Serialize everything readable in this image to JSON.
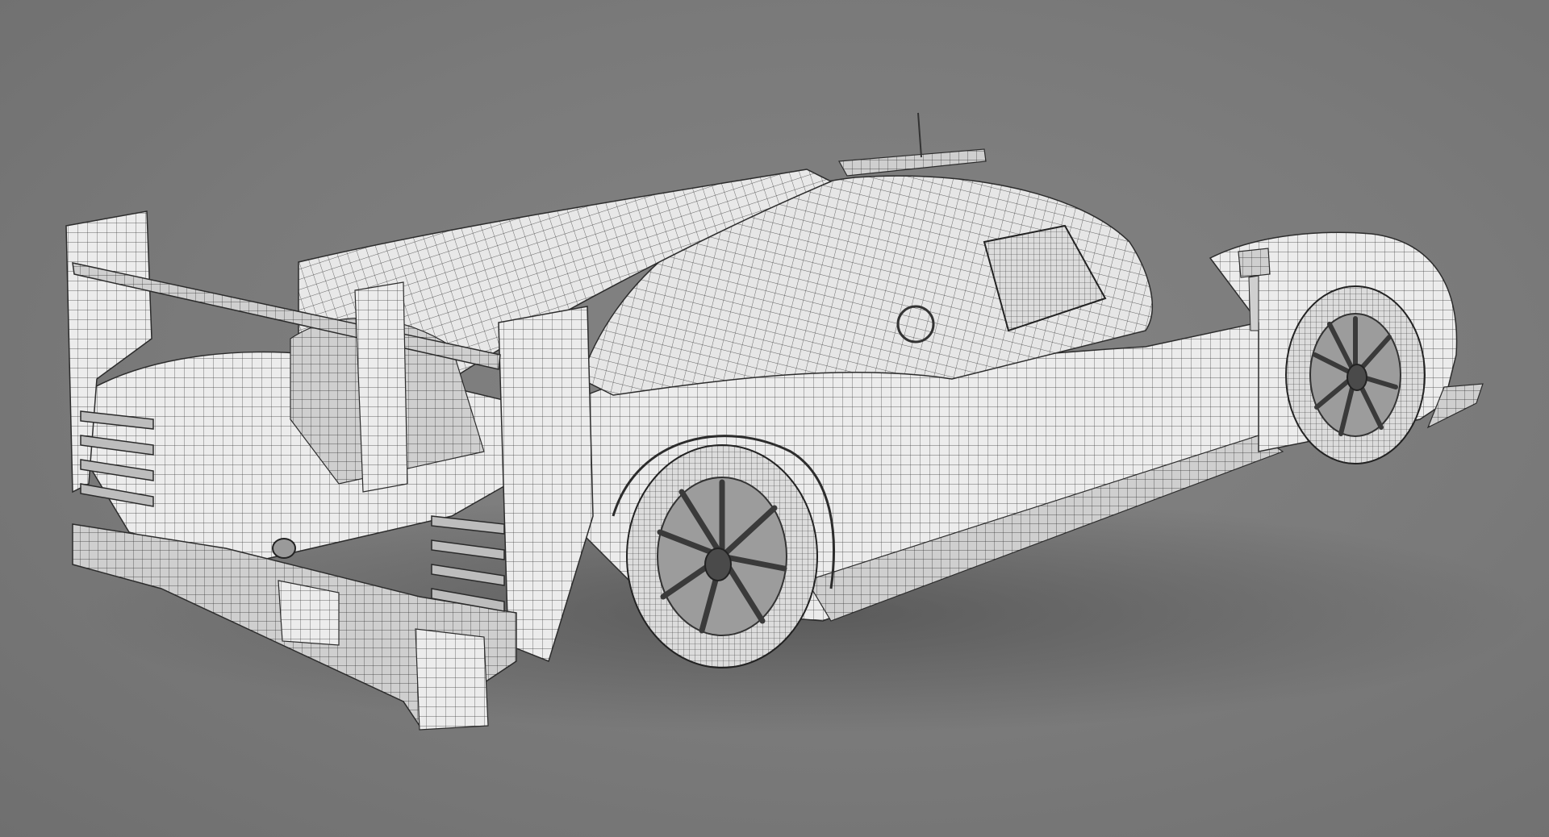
{
  "scene": {
    "background_color": "#7b7b7b",
    "surface_color": "#ececec",
    "shade_color": "#c9c9c9",
    "wire_color": "#3a3a3a",
    "tire_color": "#d8d8d8",
    "rim_color": "#5a5a5a"
  }
}
